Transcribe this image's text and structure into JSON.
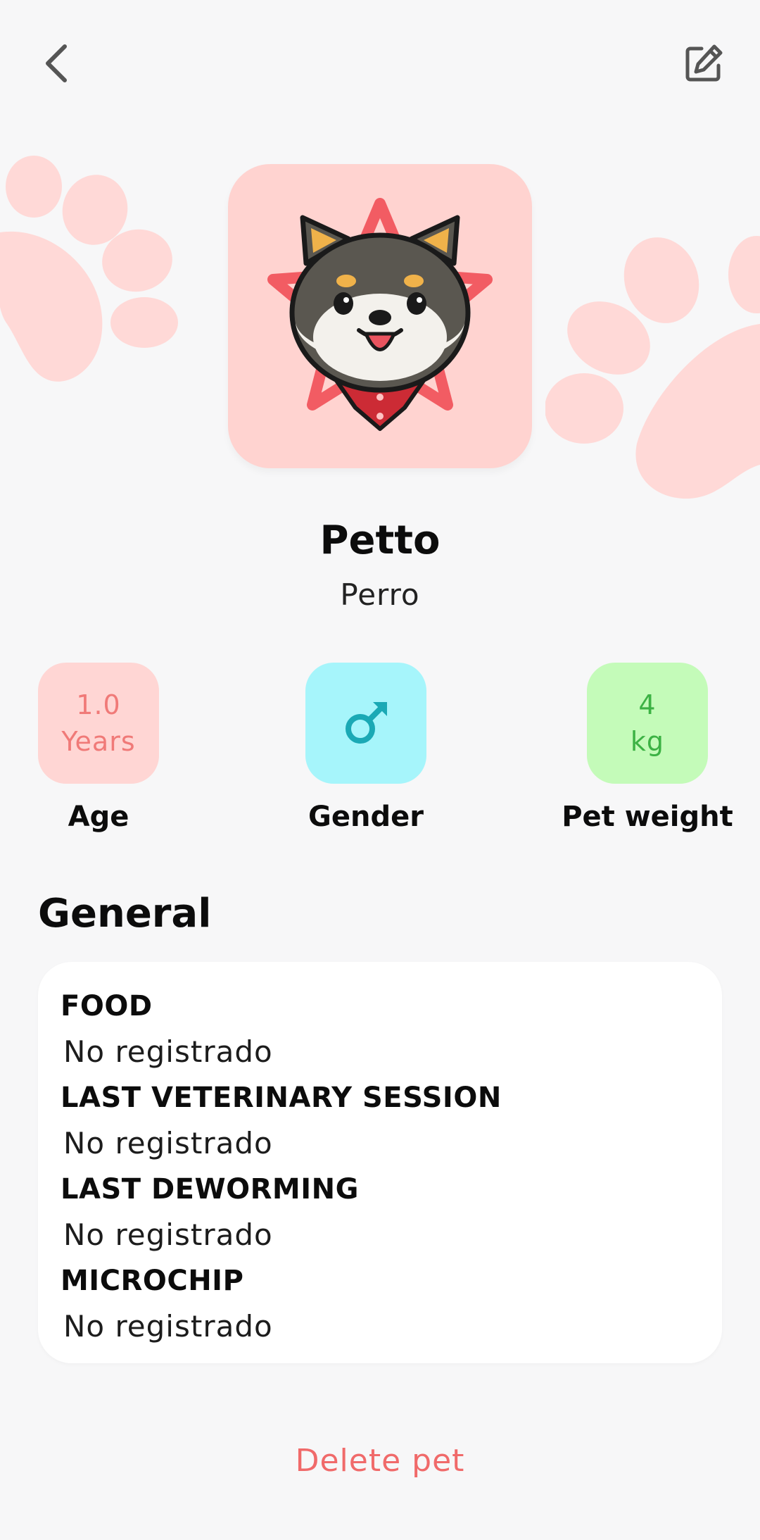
{
  "header": {
    "back_icon": "chevron-left-icon",
    "edit_icon": "edit-square-icon"
  },
  "pet": {
    "name": "Petto",
    "species": "Perro",
    "avatar": "shiba-dog-star-icon"
  },
  "stats": {
    "age": {
      "value": "1.0",
      "unit": "Years",
      "label": "Age",
      "color": "#f07a78",
      "bg": "#ffd6d4"
    },
    "gender": {
      "icon": "male-symbol-icon",
      "label": "Gender",
      "color": "#1aa9b5",
      "bg": "#a6f5fb"
    },
    "weight": {
      "value": "4",
      "unit": "kg",
      "label": "Pet weight",
      "color": "#3cb244",
      "bg": "#c4fbb9"
    }
  },
  "general": {
    "title": "General",
    "items": [
      {
        "label": "FOOD",
        "value": "No registrado"
      },
      {
        "label": "LAST VETERINARY SESSION",
        "value": "No registrado"
      },
      {
        "label": "LAST DEWORMING",
        "value": "No registrado"
      },
      {
        "label": "MICROCHIP",
        "value": "No registrado"
      }
    ]
  },
  "actions": {
    "delete_label": "Delete pet",
    "delete_color": "#f06a6a"
  },
  "theme": {
    "background": "#f7f7f8",
    "paw_color": "#ffd9d7",
    "avatar_bg": "#ffd3d0"
  }
}
